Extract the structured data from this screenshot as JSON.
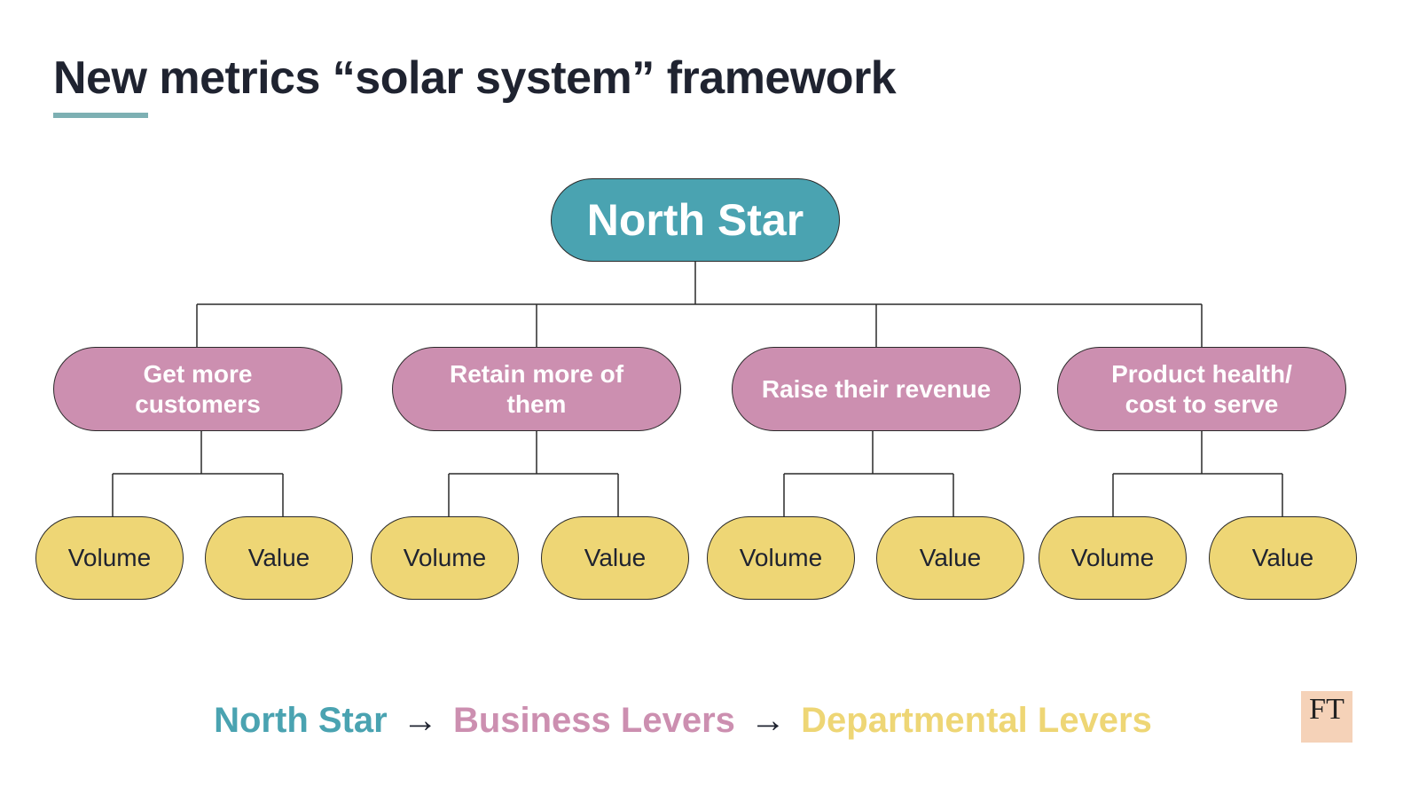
{
  "title": "New metrics “solar system” framework",
  "colors": {
    "north_star": "#4aa3b1",
    "business_lever": "#cc8fb0",
    "departmental_lever": "#eed675",
    "accent_underline": "#7db0b3"
  },
  "north_star": {
    "label": "North Star"
  },
  "business_levers": [
    {
      "label": "Get more customers",
      "children": [
        "Volume",
        "Value"
      ]
    },
    {
      "label": "Retain more of them",
      "children": [
        "Volume",
        "Value"
      ]
    },
    {
      "label": "Raise their revenue",
      "children": [
        "Volume",
        "Value"
      ]
    },
    {
      "label": "Product health/ cost to serve",
      "children": [
        "Volume",
        "Value"
      ]
    }
  ],
  "legend": {
    "north_star": "North Star",
    "business_levers": "Business Levers",
    "departmental_levers": "Departmental Levers",
    "arrow": "→"
  },
  "logo": {
    "text": "FT"
  }
}
